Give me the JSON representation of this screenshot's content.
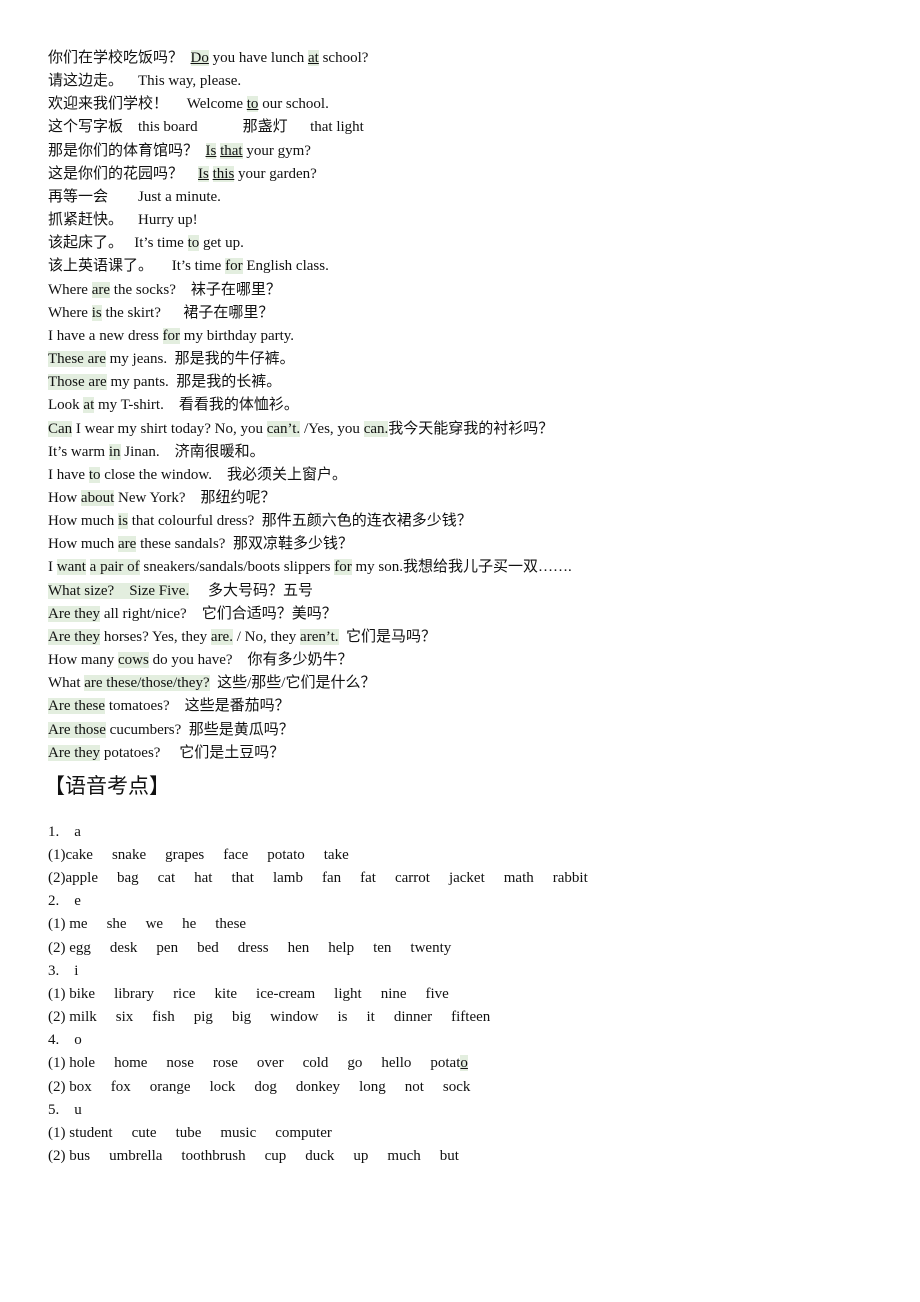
{
  "highlight_color": "#e3eedf",
  "sentences": [
    [
      "你们在学校吃饭吗？  ",
      {
        "t": "Do",
        "hl": true,
        "u": true
      },
      " you have lunch ",
      {
        "t": "at",
        "hl": true,
        "u": true
      },
      " school?"
    ],
    [
      "请这边走。    This way, please."
    ],
    [
      "欢迎来我们学校！     Welcome ",
      {
        "t": "to",
        "hl": true,
        "u": true
      },
      " our school."
    ],
    [
      "这个写字板    this board            那盏灯      that light"
    ],
    [
      "那是你们的体育馆吗？  ",
      {
        "t": "Is",
        "hl": true,
        "u": true
      },
      " ",
      {
        "t": "that",
        "hl": true,
        "u": true
      },
      " your gym?"
    ],
    [
      "这是你们的花园吗？    ",
      {
        "t": "Is",
        "hl": true,
        "u": true
      },
      " ",
      {
        "t": "this",
        "hl": true,
        "u": true
      },
      " your garden?"
    ],
    [
      "再等一会        Just a minute."
    ],
    [
      "抓紧赶快。    Hurry up!"
    ],
    [
      "该起床了。   It’s time ",
      {
        "t": "to",
        "hl": true
      },
      " get up."
    ],
    [
      "该上英语课了。     It’s time ",
      {
        "t": "for",
        "hl": true
      },
      " English class."
    ],
    [
      "Where ",
      {
        "t": "are",
        "hl": true
      },
      " the socks?    袜子在哪里？"
    ],
    [
      "Where ",
      {
        "t": "is",
        "hl": true
      },
      " the skirt?      裙子在哪里？"
    ],
    [
      "I have a new dress ",
      {
        "t": "for",
        "hl": true
      },
      " my birthday party."
    ],
    [
      {
        "t": "These are",
        "hl": true
      },
      " my jeans.  那是我的牛仔裤。"
    ],
    [
      {
        "t": "Those are",
        "hl": true
      },
      " my pants.  那是我的长裤。"
    ],
    [
      "Look ",
      {
        "t": "at",
        "hl": true
      },
      " my T-shirt.    看看我的体恤衫。"
    ],
    [
      {
        "t": "Can",
        "hl": true
      },
      " I wear my shirt today? No, you ",
      {
        "t": "can’t.",
        "hl": true
      },
      " /Yes, you ",
      {
        "t": "can.",
        "hl": true
      },
      "我今天能穿我的衬衫吗？"
    ],
    [
      "It’s warm ",
      {
        "t": "in",
        "hl": true
      },
      " Jinan.    济南很暖和。"
    ],
    [
      "I have ",
      {
        "t": "to",
        "hl": true
      },
      " close the window.    我必须关上窗户。"
    ],
    [
      "How ",
      {
        "t": "about",
        "hl": true
      },
      " New York?    那纽约呢？"
    ],
    [
      "How much ",
      {
        "t": "is",
        "hl": true
      },
      " that colourful dress?  那件五颜六色的连衣裙多少钱？"
    ],
    [
      "How much ",
      {
        "t": "are",
        "hl": true
      },
      " these sandals?  那双凉鞋多少钱？"
    ],
    [
      "I ",
      {
        "t": "want",
        "hl": true
      },
      " ",
      {
        "t": "a pair of",
        "hl": true
      },
      " sneakers/sandals/boots slippers ",
      {
        "t": "for",
        "hl": true
      },
      " my son.我想给我儿子买一双……."
    ],
    [
      {
        "t": "What size?    Size Five.",
        "hl": true
      },
      "     多大号码？五号"
    ],
    [
      {
        "t": "Are they",
        "hl": true
      },
      " all right/nice?    它们合适吗？美吗？"
    ],
    [
      {
        "t": "Are they",
        "hl": true
      },
      " horses? Yes, they ",
      {
        "t": "are.",
        "hl": true
      },
      " / No, they ",
      {
        "t": "aren’t.",
        "hl": true
      },
      "  它们是马吗？"
    ],
    [
      "How many ",
      {
        "t": "cows",
        "hl": true
      },
      " do you have?    你有多少奶牛？"
    ],
    [
      "What ",
      {
        "t": "are these/those/they?",
        "hl": true
      },
      "  这些/那些/它们是什么？"
    ],
    [
      {
        "t": "Are these",
        "hl": true
      },
      " tomatoes?    这些是番茄吗？"
    ],
    [
      {
        "t": "Are those",
        "hl": true
      },
      " cucumbers?  那些是黄瓜吗？"
    ],
    [
      {
        "t": "Are they",
        "hl": true
      },
      " potatoes?     它们是土豆吗？"
    ]
  ],
  "phonics_heading": "【语音考点】",
  "phonics": [
    [
      [
        "1.    a"
      ]
    ],
    [
      [
        "(1)cake"
      ],
      [
        "snake"
      ],
      [
        "grapes"
      ],
      [
        "face"
      ],
      [
        "potato"
      ],
      [
        "take"
      ]
    ],
    [
      [
        "(2)apple"
      ],
      [
        "bag"
      ],
      [
        "cat"
      ],
      [
        "hat"
      ],
      [
        "that"
      ],
      [
        "lamb"
      ],
      [
        "fan"
      ],
      [
        "fat"
      ],
      [
        "carrot"
      ],
      [
        "jacket"
      ],
      [
        "math"
      ],
      [
        "rabbit"
      ]
    ],
    [
      [
        "2.    e"
      ]
    ],
    [
      [
        "(1) me"
      ],
      [
        "she"
      ],
      [
        "we"
      ],
      [
        "he"
      ],
      [
        "these"
      ]
    ],
    [
      [
        "(2) egg"
      ],
      [
        "desk"
      ],
      [
        "pen"
      ],
      [
        "bed"
      ],
      [
        "dress"
      ],
      [
        "hen"
      ],
      [
        "help"
      ],
      [
        "ten"
      ],
      [
        "twenty"
      ]
    ],
    [
      [
        "3.    i"
      ]
    ],
    [
      [
        "(1) bike"
      ],
      [
        "library"
      ],
      [
        "rice"
      ],
      [
        "kite"
      ],
      [
        "ice-cream"
      ],
      [
        "light"
      ],
      [
        "nine"
      ],
      [
        "five"
      ]
    ],
    [
      [
        "(2) milk"
      ],
      [
        "six"
      ],
      [
        "fish"
      ],
      [
        "pig"
      ],
      [
        "big"
      ],
      [
        "window"
      ],
      [
        "is"
      ],
      [
        "it"
      ],
      [
        "dinner"
      ],
      [
        "fifteen"
      ]
    ],
    [
      [
        "4.    o"
      ]
    ],
    [
      [
        "(1) hole"
      ],
      [
        "home"
      ],
      [
        "nose"
      ],
      [
        "rose"
      ],
      [
        "over"
      ],
      [
        "cold"
      ],
      [
        "go"
      ],
      [
        "hello"
      ],
      [
        "potat",
        {
          "t": "o",
          "hl": true,
          "u": true
        }
      ]
    ],
    [
      [
        "(2) box"
      ],
      [
        "fox"
      ],
      [
        "orange"
      ],
      [
        "lock"
      ],
      [
        "dog"
      ],
      [
        "donkey"
      ],
      [
        "long"
      ],
      [
        "not"
      ],
      [
        "sock"
      ]
    ],
    [
      [
        "5.    u"
      ]
    ],
    [
      [
        "(1) student"
      ],
      [
        "cute"
      ],
      [
        "tube"
      ],
      [
        "music"
      ],
      [
        "computer"
      ]
    ],
    [
      [
        "(2) bus"
      ],
      [
        "umbrella"
      ],
      [
        "toothbrush"
      ],
      [
        "cup"
      ],
      [
        "duck"
      ],
      [
        "up"
      ],
      [
        "much"
      ],
      [
        "but"
      ]
    ]
  ]
}
